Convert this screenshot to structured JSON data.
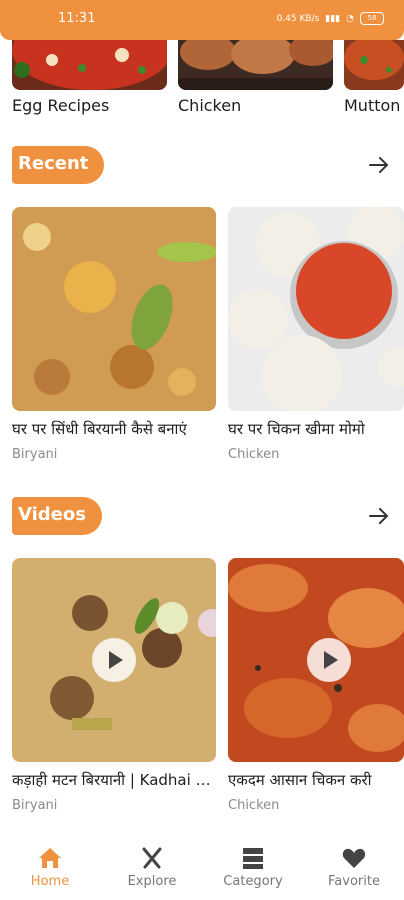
{
  "status_bar": {
    "time": "11:31",
    "network": "0.45 KB/s",
    "battery": "58"
  },
  "categories": [
    {
      "label": "Egg Recipes"
    },
    {
      "label": "Chicken"
    },
    {
      "label": "Mutton"
    }
  ],
  "recent": {
    "title": "Recent",
    "items": [
      {
        "title": "घर पर सिंधी बिरयानी कैसे बनाएं",
        "tag": "Biryani"
      },
      {
        "title": "घर पर चिकन खीमा मोमो",
        "tag": "Chicken"
      }
    ]
  },
  "videos": {
    "title": "Videos",
    "items": [
      {
        "title": "कड़ाही मटन बिरयानी | Kadhai Mutton Biryani",
        "tag": "Biryani"
      },
      {
        "title": "एकदम आसान चिकन करी",
        "tag": "Chicken"
      }
    ]
  },
  "nav": [
    {
      "label": "Home",
      "active": true
    },
    {
      "label": "Explore",
      "active": false
    },
    {
      "label": "Category",
      "active": false
    },
    {
      "label": "Favorite",
      "active": false
    }
  ],
  "colors": {
    "accent": "#f0913f",
    "muted": "#8a8a8a"
  }
}
